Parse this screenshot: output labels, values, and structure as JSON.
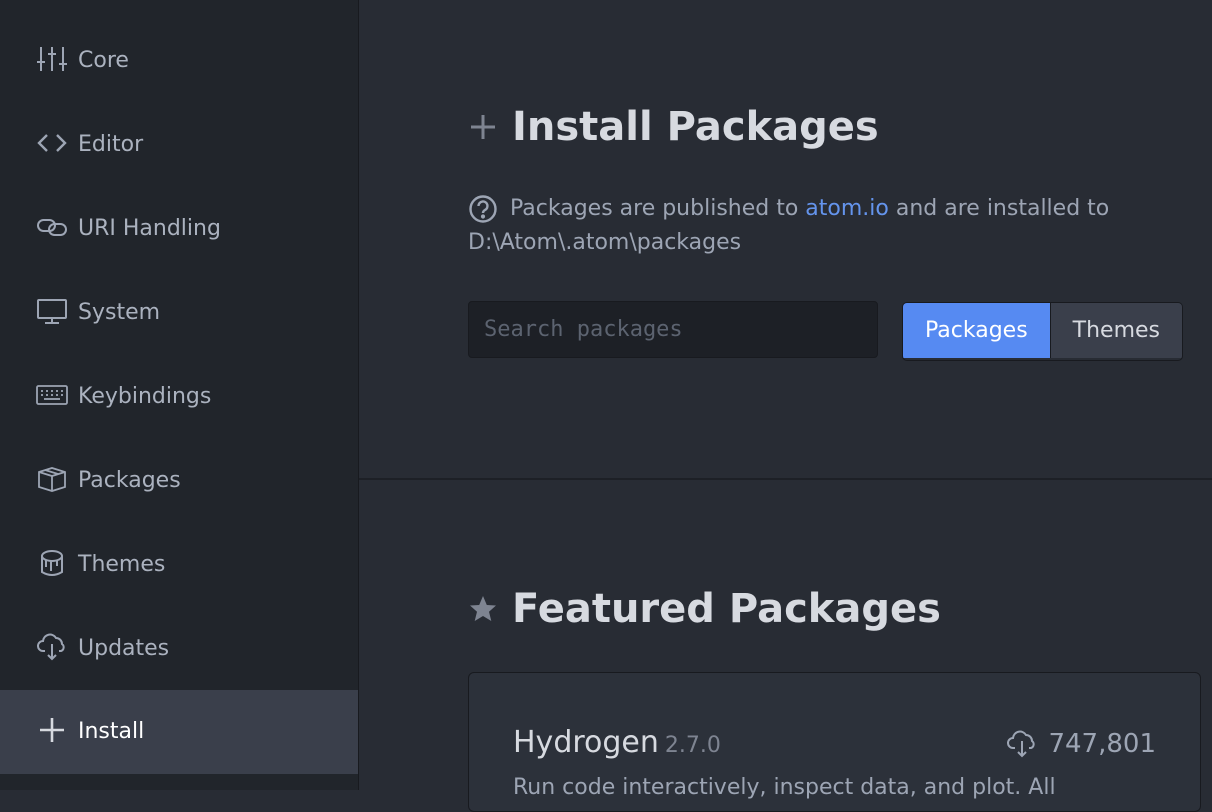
{
  "sidebar": {
    "items": [
      {
        "label": "Core",
        "icon": "settings-sliders-icon"
      },
      {
        "label": "Editor",
        "icon": "code-icon"
      },
      {
        "label": "URI Handling",
        "icon": "link-icon"
      },
      {
        "label": "System",
        "icon": "monitor-icon"
      },
      {
        "label": "Keybindings",
        "icon": "keyboard-icon"
      },
      {
        "label": "Packages",
        "icon": "package-icon"
      },
      {
        "label": "Themes",
        "icon": "paintcan-icon"
      },
      {
        "label": "Updates",
        "icon": "cloud-download-icon"
      },
      {
        "label": "Install",
        "icon": "plus-icon",
        "active": true
      }
    ]
  },
  "install": {
    "title": "Install Packages",
    "info_prefix": "Packages are published to ",
    "info_link": "atom.io",
    "info_suffix": " and are installed to",
    "info_path": "D:\\Atom\\.atom\\packages",
    "search_placeholder": "Search packages",
    "toggle": {
      "packages": "Packages",
      "themes": "Themes",
      "selected": "Packages"
    }
  },
  "featured": {
    "title": "Featured Packages",
    "cards": [
      {
        "name": "Hydrogen",
        "version": "2.7.0",
        "downloads": "747,801",
        "description": "Run code interactively, inspect data, and plot. All"
      }
    ]
  },
  "colors": {
    "accent": "#568af2",
    "link": "#6494ed",
    "background": "#282c34",
    "sidebar": "#21252b"
  }
}
